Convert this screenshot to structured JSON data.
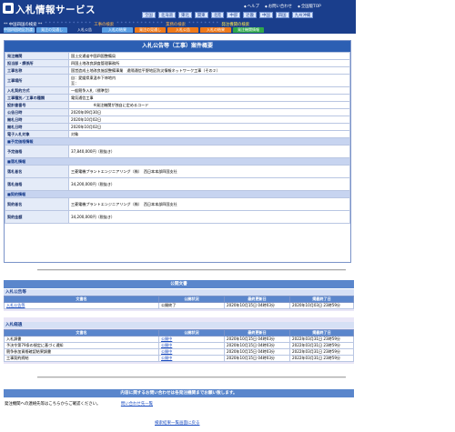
{
  "header": {
    "title": "入札情報サービス",
    "utility_links": [
      "ヘルプ",
      "お問い合わせ",
      "全国版TOP"
    ],
    "regions": [
      "全国",
      "北海道",
      "東北",
      "関東",
      "北陸",
      "中部",
      "近畿",
      "中国",
      "四国",
      "九州沖縄"
    ],
    "row2": {
      "left": "** 中国四国の検索 **",
      "mid": "工事の検索",
      "right": "業務の検索",
      "far": "発注機関の検索"
    },
    "tabs": [
      {
        "label": "中国四国地区別渡し",
        "color": "#5aa0e6"
      },
      {
        "label": "発注の見通し",
        "color": "#5aa0e6"
      },
      {
        "label": "入札公告",
        "color": "#1a3e8c"
      },
      {
        "label": "入札の結果",
        "color": "#5aa0e6"
      },
      {
        "label": "発注の見通し",
        "color": "#f07a1a"
      },
      {
        "label": "入札公告",
        "color": "#f07a1a"
      },
      {
        "label": "入札の結果",
        "color": "#f07a1a"
      },
      {
        "label": "発注機関情報",
        "color": "#2fa84a"
      }
    ]
  },
  "announcement": {
    "title": "入札公告等（工事）案件概要",
    "rows": [
      {
        "key": "発注機関",
        "value": "国土交通省中国四国整備局"
      },
      {
        "key": "担当部・課係所",
        "value": "四国土地改良調査管理事務所"
      },
      {
        "key": "工事名称",
        "value": "国営造成土地改良施設整備事業　遠隔通信平野地区防災情報ネットワーク工事（その２）"
      },
      {
        "key": "工事場所",
        "value": "自：愛媛県東温市下林地内\n至："
      },
      {
        "key": "入札契約方式",
        "value": "一般競争入札（標準型）"
      },
      {
        "key": "工事種別／工事の種類",
        "value": "電気通信工事"
      },
      {
        "key": "設計書番号",
        "value": "　　　　　　※発注機関が独自に定めるコード"
      },
      {
        "key": "公告日時",
        "value": "2020年09月30日"
      },
      {
        "key": "開札日時",
        "value": "2020年10月02日"
      },
      {
        "key": "開札日時",
        "value": "2020年10月02日"
      },
      {
        "key": "電子入札対象",
        "value": "対象"
      }
    ],
    "estimate_section": "■予定価格情報",
    "estimate": [
      {
        "key": "予定価格",
        "value": "37,840,000円（税抜き）"
      }
    ],
    "bid_section": "■落札情報",
    "bid": [
      {
        "key": "落札者名",
        "value": "三菱電機プラントエンジニアリング（株）　西日本本部四国支社"
      },
      {
        "key": "落札価格",
        "value": "34,200,000円（税抜き）"
      }
    ],
    "contract_section": "■契約情報",
    "contract": [
      {
        "key": "契約者名",
        "value": "三菱電機プラントエンジニアリング（株）　西日本本部四国支社"
      },
      {
        "key": "契約金額",
        "value": "34,200,000円（税抜き）"
      }
    ]
  },
  "documents": {
    "title": "公開文書",
    "subtitle": "入札公告等",
    "headers": [
      "文書名",
      "公開状況",
      "最終更新日",
      "掲載終了日"
    ],
    "rows": [
      [
        "入札公告等",
        "公開終了",
        "2020年10月15日 04時03分",
        "2020年10月03日 23時59分"
      ]
    ]
  },
  "results": {
    "subtitle": "入札経過",
    "headers": [
      "文書名",
      "公開状況",
      "最終更新日",
      "掲載終了日"
    ],
    "rows": [
      [
        "入札調書",
        "公開中",
        "2020年10月15日 04時03分",
        "2022年03月31日 23時59分"
      ],
      [
        "予決令第79条の規定に基づく通知",
        "公開中",
        "2020年10月15日 04時03分",
        "2022年03月31日 23時59分"
      ],
      [
        "競争参加資格確認結果調書",
        "公開中",
        "2020年10月15日 04時03分",
        "2022年03月31日 23時59分"
      ],
      [
        "工事契約締結",
        "公開中",
        "2020年10月15日 04時03分",
        "2022年03月31日 23時59分"
      ]
    ]
  },
  "contact": {
    "banner": "内容に関するお問い合わせは各発注機関までお願い致します。",
    "label": "発注機関への連絡先等はこちらからご確認ください。",
    "link": "問い合わせ先一覧"
  },
  "footer": {
    "link": "検索結果一覧画面に戻る"
  }
}
